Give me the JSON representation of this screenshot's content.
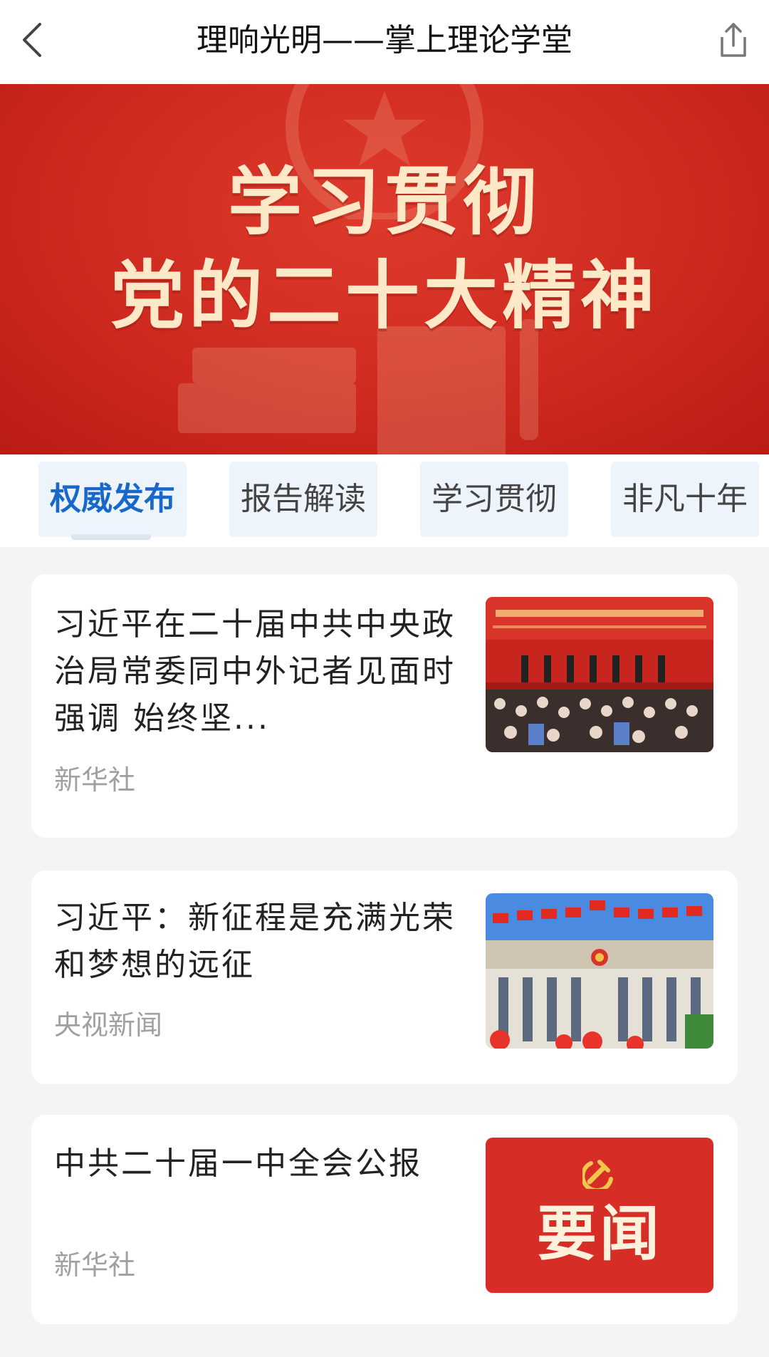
{
  "header": {
    "back_icon": "chevron-left-icon",
    "title": "理响光明——掌上理论学堂",
    "share_icon": "share-icon"
  },
  "banner": {
    "line1": "学习贯彻",
    "line2": "党的二十大精神",
    "colors": {
      "background": "#cf2a20",
      "text": "#fde8c8"
    }
  },
  "tabs": [
    {
      "label": "权威发布",
      "active": true
    },
    {
      "label": "报告解读",
      "active": false
    },
    {
      "label": "学习贯彻",
      "active": false
    },
    {
      "label": "非凡十年",
      "active": false
    }
  ],
  "articles": [
    {
      "title": "习近平在二十届中共中央政治局常委同中外记者见面时强调 始终坚...",
      "source": "新华社",
      "thumbnail": "press-conference-photo"
    },
    {
      "title": "习近平：新征程是充满光荣和梦想的远征",
      "source": "央视新闻",
      "thumbnail": "great-hall-photo"
    },
    {
      "title": "中共二十届一中全会公报",
      "source": "新华社",
      "thumbnail": "news-badge",
      "thumbnail_text": "要闻"
    }
  ],
  "accent_color": "#1768c9"
}
